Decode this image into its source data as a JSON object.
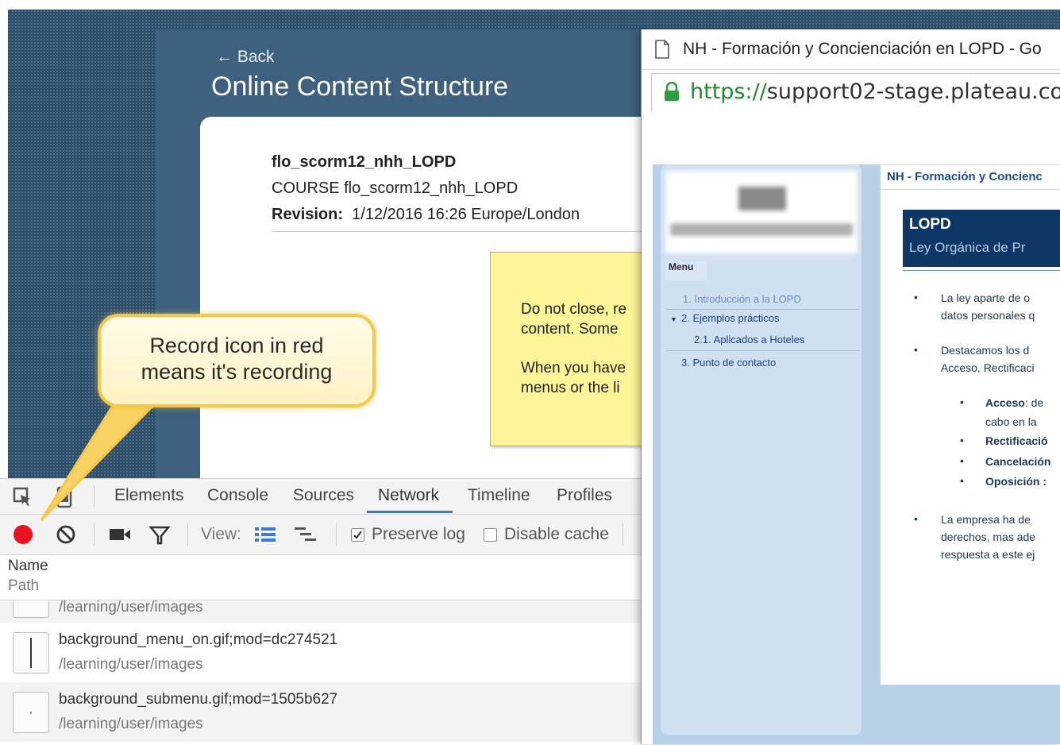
{
  "background_page": {
    "back_link": "← Back",
    "title": "Online Content Structure",
    "course_name": "flo_scorm12_nhh_LOPD",
    "course_line": "COURSE flo_scorm12_nhh_LOPD",
    "revision_label": "Revision:",
    "revision_value": "1/12/2016 16:26 Europe/London",
    "sticky_note": {
      "line1": "Do not close, re",
      "line2": "content. Some",
      "line3": "When you have",
      "line4": "menus or the li"
    }
  },
  "callout": {
    "line1": "Record icon in red",
    "line2": "means it's recording"
  },
  "devtools": {
    "tabs": [
      "Elements",
      "Console",
      "Sources",
      "Network",
      "Timeline",
      "Profiles"
    ],
    "active_tab": "Network",
    "toolbar": {
      "view_label": "View:",
      "preserve_log_label": "Preserve log",
      "preserve_log_checked": true,
      "disable_cache_label": "Disable cache",
      "disable_cache_checked": false,
      "record_color": "#e8131f"
    },
    "columns": {
      "name": "Name",
      "path": "Path"
    },
    "requests": [
      {
        "name": "",
        "path": "/learning/user/images"
      },
      {
        "name": "background_menu_on.gif;mod=dc274521",
        "path": "/learning/user/images"
      },
      {
        "name": "background_submenu.gif;mod=1505b627",
        "path": "/learning/user/images"
      }
    ]
  },
  "popup": {
    "window_title": "NH - Formación y Concienciación en LOPD - Go",
    "url_scheme": "https://",
    "url_rest": "support02-stage.plateau.cor",
    "course_header": "NH - Formación y Concienc",
    "menu_tab": "Menu",
    "menu_items": [
      {
        "label": "1. Introducción a la LOPD"
      },
      {
        "label": "2. Ejemplos prácticos"
      },
      {
        "label": "2.1. Aplicados a Hoteles"
      },
      {
        "label": "3. Punto de contacto"
      }
    ],
    "banner_title": "LOPD",
    "banner_subtitle": "Ley Orgánica de Pr",
    "body": {
      "p1a": "La ley aparte de o",
      "p1b": "datos personales q",
      "p2a": "Destacamos los d",
      "p2b": "Acceso, Rectificaci",
      "sub1a": "Acceso",
      "sub1b": ": de",
      "sub1c": "cabo en la",
      "sub2": "Rectificació",
      "sub3": "Cancelación",
      "sub4": "Oposición :",
      "p3a": "La empresa ha de",
      "p3b": "derechos, mas ade",
      "p3c": "respuesta a este ej"
    }
  },
  "colors": {
    "page_background": "#2e4f6c",
    "accent_blue": "#3879d9",
    "record_red": "#e8131f",
    "callout_border": "#f5c84a"
  }
}
